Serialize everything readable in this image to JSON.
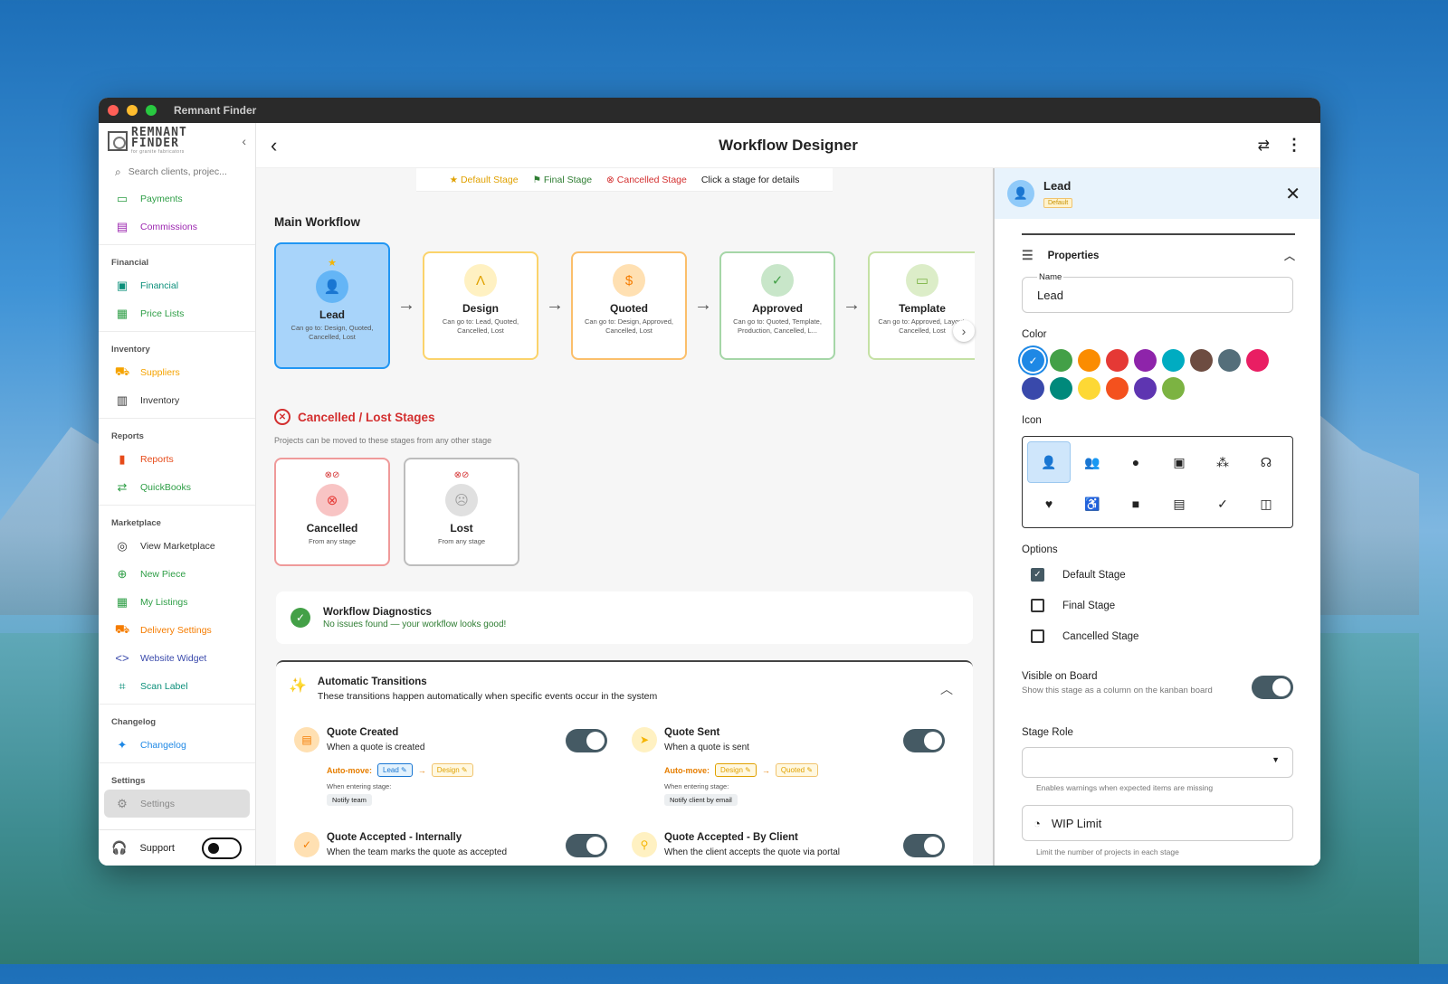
{
  "window": {
    "title": "Remnant Finder"
  },
  "logo": {
    "line1": "REMNANT",
    "line2": "FINDER",
    "tagline": "for granite fabricators"
  },
  "sidebar": {
    "search_placeholder": "Search clients, projec...",
    "top_items": [
      {
        "label": "Payments",
        "color": "#2e9e46"
      },
      {
        "label": "Commissions",
        "color": "#9c27b0"
      }
    ],
    "sections": [
      {
        "title": "Financial",
        "items": [
          {
            "label": "Financial",
            "color": "#0b8f7a"
          },
          {
            "label": "Price Lists",
            "color": "#2e9e46"
          }
        ]
      },
      {
        "title": "Inventory",
        "items": [
          {
            "label": "Suppliers",
            "color": "#f5a300"
          },
          {
            "label": "Inventory",
            "color": "#333333"
          }
        ]
      },
      {
        "title": "Reports",
        "items": [
          {
            "label": "Reports",
            "color": "#e64a19"
          },
          {
            "label": "QuickBooks",
            "color": "#2e9e46"
          }
        ]
      },
      {
        "title": "Marketplace",
        "items": [
          {
            "label": "View Marketplace",
            "color": "#333333"
          },
          {
            "label": "New Piece",
            "color": "#2e9e46"
          },
          {
            "label": "My Listings",
            "color": "#2e9e46"
          },
          {
            "label": "Delivery Settings",
            "color": "#f57c00"
          },
          {
            "label": "Website Widget",
            "color": "#3949ab"
          },
          {
            "label": "Scan Label",
            "color": "#0b8f7a"
          }
        ]
      },
      {
        "title": "Changelog",
        "items": [
          {
            "label": "Changelog",
            "color": "#1e88e5"
          }
        ]
      },
      {
        "title": "Settings",
        "items": [
          {
            "label": "Settings",
            "color": "#888888"
          }
        ]
      }
    ],
    "support_label": "Support"
  },
  "topbar": {
    "title": "Workflow Designer"
  },
  "legend": {
    "default": "Default Stage",
    "final": "Final Stage",
    "cancelled": "Cancelled Stage",
    "hint": "Click a stage for details"
  },
  "workflow": {
    "heading": "Main Workflow",
    "stages": [
      {
        "name": "Lead",
        "sub": "Can go to: Design, Quoted, Cancelled, Lost",
        "border": "#2196f3",
        "bg": "#a8d4fa",
        "circle": "#64b5f6",
        "icon": "add-person"
      },
      {
        "name": "Design",
        "sub": "Can go to: Lead, Quoted, Cancelled, Lost",
        "border": "#fbd36b",
        "bg": "#ffffff",
        "circle": "#fff1c2",
        "icon": "compass"
      },
      {
        "name": "Quoted",
        "sub": "Can go to: Design, Approved, Cancelled, Lost",
        "border": "#fbbf6b",
        "bg": "#ffffff",
        "circle": "#ffe0b2",
        "icon": "invoice"
      },
      {
        "name": "Approved",
        "sub": "Can go to: Quoted, Template, Production, Cancelled, L...",
        "border": "#a5d6a7",
        "bg": "#ffffff",
        "circle": "#c8e6c9",
        "icon": "check"
      },
      {
        "name": "Template",
        "sub": "Can go to: Approved, Layout, Cancelled, Lost",
        "border": "#c5e1a5",
        "bg": "#ffffff",
        "circle": "#dcedc8",
        "icon": "ruler"
      }
    ]
  },
  "cancelled": {
    "heading": "Cancelled / Lost Stages",
    "caption": "Projects can be moved to these stages from any other stage",
    "stages": [
      {
        "name": "Cancelled",
        "sub": "From any stage",
        "border": "#ef9a9a",
        "circle": "#f8c4c4"
      },
      {
        "name": "Lost",
        "sub": "From any stage",
        "border": "#bdbdbd",
        "circle": "#e0e0e0"
      }
    ]
  },
  "diagnostics": {
    "title": "Workflow Diagnostics",
    "message": "No issues found — your workflow looks good!"
  },
  "automatic": {
    "title": "Automatic Transitions",
    "subtitle": "These transitions happen automatically when specific events occur in the system",
    "auto_move_label": "Auto-move:",
    "when_label": "When entering stage:",
    "items": [
      {
        "title": "Quote Created",
        "sub": "When a quote is created",
        "from": "Lead",
        "to": "Design",
        "notify": "Notify team",
        "on": true
      },
      {
        "title": "Quote Sent",
        "sub": "When a quote is sent",
        "from": "Design",
        "to": "Quoted",
        "notify": "Notify client by email",
        "on": true
      },
      {
        "title": "Quote Accepted - Internally",
        "sub": "When the team marks the quote as accepted",
        "on": true
      },
      {
        "title": "Quote Accepted - By Client",
        "sub": "When the client accepts the quote via portal",
        "on": true
      }
    ]
  },
  "panel": {
    "stage_name": "Lead",
    "badge": "Default",
    "properties_label": "Properties",
    "name_label": "Name",
    "name_value": "Lead",
    "color_label": "Color",
    "colors": [
      "#1e88e5",
      "#43a047",
      "#fb8c00",
      "#e53935",
      "#8e24aa",
      "#00acc1",
      "#6d4c41",
      "#546e7a",
      "#e91e63",
      "#3949ab",
      "#00897b",
      "#fdd835",
      "#f4511e",
      "#5e35b1",
      "#7cb342"
    ],
    "selected_color": "#1e88e5",
    "icon_label": "Icon",
    "options_label": "Options",
    "options": [
      {
        "label": "Default Stage",
        "checked": true
      },
      {
        "label": "Final Stage",
        "checked": false
      },
      {
        "label": "Cancelled Stage",
        "checked": false
      }
    ],
    "visible_title": "Visible on Board",
    "visible_desc": "Show this stage as a column on the kanban board",
    "role_label": "Stage Role",
    "role_hint": "Enables warnings when expected items are missing",
    "wip_label": "WIP Limit",
    "wip_hint": "Limit the number of projects in each stage"
  }
}
